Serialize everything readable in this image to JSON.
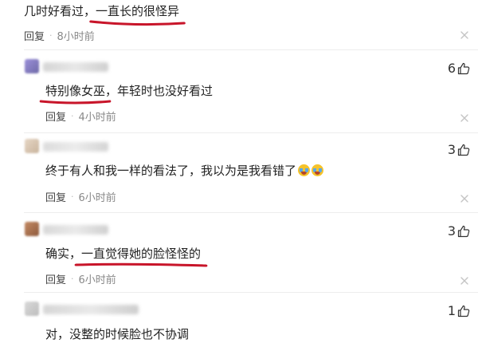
{
  "colors": {
    "highlight_underline": "#c8152a",
    "meta_text": "#888888",
    "divider": "#ededed",
    "close_icon": "#c4c4c4"
  },
  "icons": {
    "like": "thumbs-up-icon",
    "close": "close-icon",
    "emoji": "laughing-crying-emoji-icon"
  },
  "top_comment": {
    "text_before": "几时好看过，",
    "text_highlight": "一直长的很怪异",
    "text_after": "",
    "reply_label": "回复",
    "separator": "·",
    "time": "8小时前"
  },
  "replies": [
    {
      "text_before": "",
      "text_highlight": "特别像女巫",
      "text_after": "，年轻时也没好看过",
      "likes": "6",
      "reply_label": "回复",
      "separator": "·",
      "time": "4小时前"
    },
    {
      "text_before": "终于有人和我一样的看法了，我以为是我看错了",
      "text_highlight": "",
      "text_after": "",
      "likes": "3",
      "reply_label": "回复",
      "separator": "·",
      "time": "6小时前"
    },
    {
      "text_before": "确实，",
      "text_highlight": "一直觉得她的脸怪怪的",
      "text_after": "",
      "likes": "3",
      "reply_label": "回复",
      "separator": "·",
      "time": "6小时前"
    },
    {
      "text_before": "对，没整的时候脸也不协调",
      "text_highlight": "",
      "text_after": "",
      "likes": "1"
    }
  ]
}
